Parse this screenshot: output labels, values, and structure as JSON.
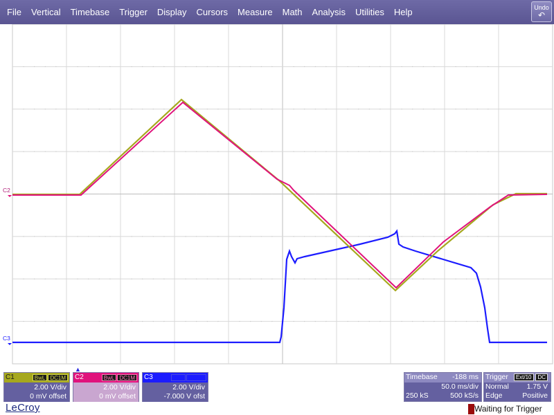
{
  "menu": [
    "File",
    "Vertical",
    "Timebase",
    "Trigger",
    "Display",
    "Cursors",
    "Measure",
    "Math",
    "Analysis",
    "Utilities",
    "Help"
  ],
  "undo": {
    "label": "Undo",
    "icon": "undo-arrow-icon"
  },
  "waveform_labels": {
    "c2": "C2",
    "c3": "C3"
  },
  "channels": {
    "c1": {
      "name": "C1",
      "tags": [
        "BwL",
        "DC1M"
      ],
      "scale": "2.00 V/div",
      "offset": "0 mV offset",
      "color": "#a6a81e"
    },
    "c2": {
      "name": "C2",
      "tags": [
        "BwL",
        "DC1M"
      ],
      "scale": "2.00 V/div",
      "offset": "0 mV offset",
      "color": "#e0127c"
    },
    "c3": {
      "name": "C3",
      "tags": [
        "BwL",
        "DC1M"
      ],
      "scale": "2.00 V/div",
      "offset": "-7.000 V ofst",
      "color": "#1c1cff"
    }
  },
  "timebase": {
    "label": "Timebase",
    "delay": "-188 ms",
    "per_div": "50.0 ms/div",
    "samples": "250 kS",
    "rate": "500 kS/s"
  },
  "trigger": {
    "label": "Trigger",
    "source": "Ext/10",
    "coupling": "DC",
    "mode": "Normal",
    "level": "1.75 V",
    "type": "Edge",
    "slope": "Positive"
  },
  "brand": "LeCroy",
  "status": "Waiting for Trigger",
  "colors": {
    "menubar": "#5a5592",
    "panel": "#6460a0",
    "c1": "#a6a81e",
    "c2": "#e0127c",
    "c3": "#1c1cff"
  }
}
